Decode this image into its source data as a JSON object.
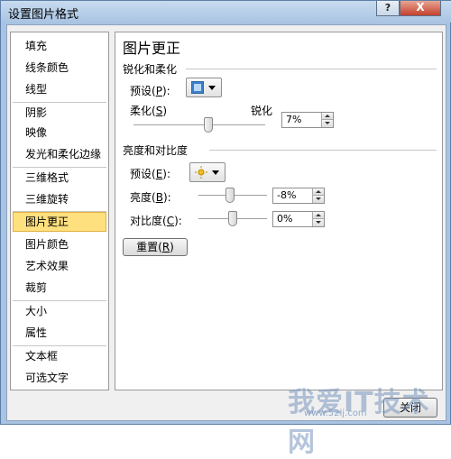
{
  "window": {
    "title": "设置图片格式",
    "help_label": "?",
    "close_label": "X"
  },
  "nav": [
    {
      "label": "填充",
      "selected": false
    },
    {
      "label": "线条颜色",
      "selected": false
    },
    {
      "label": "线型",
      "selected": false
    },
    {
      "label": "阴影",
      "selected": false
    },
    {
      "label": "映像",
      "selected": false
    },
    {
      "label": "发光和柔化边缘",
      "selected": false
    },
    {
      "label": "三维格式",
      "selected": false
    },
    {
      "label": "三维旋转",
      "selected": false
    },
    {
      "label": "图片更正",
      "selected": true
    },
    {
      "label": "图片颜色",
      "selected": false
    },
    {
      "label": "艺术效果",
      "selected": false
    },
    {
      "label": "裁剪",
      "selected": false
    },
    {
      "label": "大小",
      "selected": false
    },
    {
      "label": "属性",
      "selected": false
    },
    {
      "label": "文本框",
      "selected": false
    },
    {
      "label": "可选文字",
      "selected": false
    }
  ],
  "panel": {
    "title": "图片更正",
    "sharpen_section": {
      "heading": "锐化和柔化",
      "preset_label": "预设",
      "preset_key": "P",
      "soften_label": "柔化",
      "soften_key": "S",
      "sharpen_label": "锐化",
      "value": "7%",
      "slider_fraction": 0.57
    },
    "brightness_section": {
      "heading": "亮度和对比度",
      "preset_label": "预设",
      "preset_key": "E",
      "brightness_label": "亮度",
      "brightness_key": "B",
      "brightness_value": "-8%",
      "brightness_fraction": 0.46,
      "contrast_label": "对比度",
      "contrast_key": "C",
      "contrast_value": "0%",
      "contrast_fraction": 0.5,
      "reset_label": "重置",
      "reset_key": "R"
    }
  },
  "footer": {
    "close_label": "关闭"
  },
  "watermark": {
    "text": "我爱IT技术网",
    "url": "www.52ij.com"
  },
  "colors": {
    "selected_bg": "#ffe07f",
    "title_bg": "#a9c4e2",
    "close_btn": "#c4402a"
  }
}
